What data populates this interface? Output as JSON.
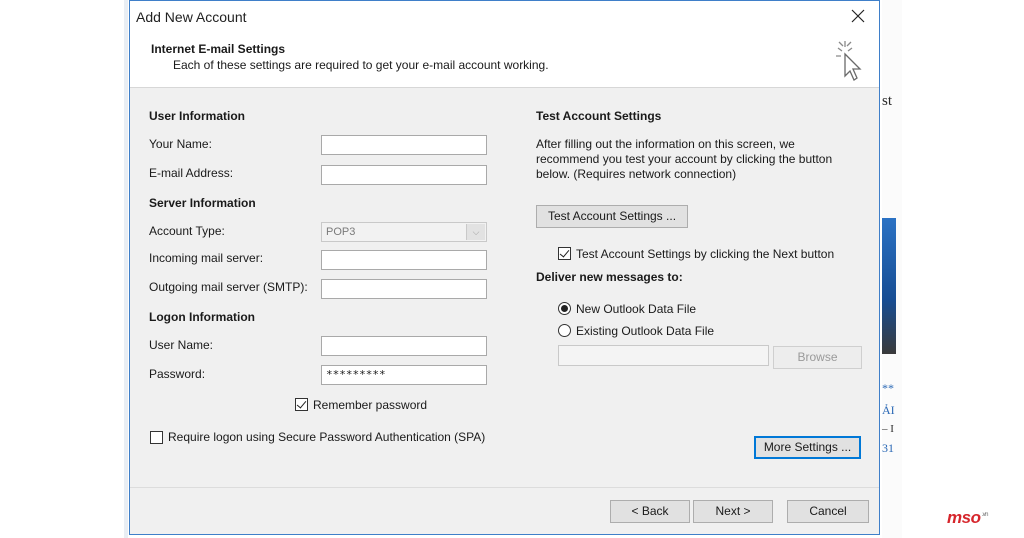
{
  "dialog": {
    "title": "Add New Account",
    "header_title": "Internet E-mail Settings",
    "header_subtitle": "Each of these settings are required to get your e-mail account working."
  },
  "user_info": {
    "heading": "User Information",
    "name_label": "Your Name:",
    "name_value": "",
    "email_label": "E-mail Address:",
    "email_value": ""
  },
  "server_info": {
    "heading": "Server Information",
    "account_type_label": "Account Type:",
    "account_type_value": "POP3",
    "incoming_label": "Incoming mail server:",
    "incoming_value": "",
    "outgoing_label": "Outgoing mail server (SMTP):",
    "outgoing_value": ""
  },
  "logon_info": {
    "heading": "Logon Information",
    "username_label": "User Name:",
    "username_value": "",
    "password_label": "Password:",
    "password_value": "*********",
    "remember_label": "Remember password",
    "remember_checked": true,
    "spa_label": "Require logon using Secure Password Authentication (SPA)",
    "spa_checked": false
  },
  "test_settings": {
    "heading": "Test Account Settings",
    "description": "After filling out the information on this screen, we recommend you test your account by clicking the button below. (Requires network connection)",
    "button_label": "Test Account Settings ...",
    "auto_test_label": "Test Account Settings by clicking the Next button",
    "auto_test_checked": true
  },
  "deliver": {
    "heading": "Deliver new messages to:",
    "new_file_label": "New Outlook Data File",
    "existing_file_label": "Existing Outlook Data File",
    "selected": "new",
    "path_value": "",
    "browse_label": "Browse"
  },
  "more_settings_label": "More Settings ...",
  "footer": {
    "back_label": "< Back",
    "next_label": "Next >",
    "cancel_label": "Cancel"
  },
  "background": {
    "frag_top": "st",
    "frag_stars": "**",
    "frag_a": "ẢI",
    "frag_dash": "– I",
    "frag_num": "31"
  },
  "logo": {
    "text": "mso",
    "suffix": ".vn",
    "color": "#d6262c"
  },
  "colors": {
    "accent": "#0078d7",
    "dialog_border": "#3f7fc9",
    "dialog_bg": "#f0f0f0"
  }
}
